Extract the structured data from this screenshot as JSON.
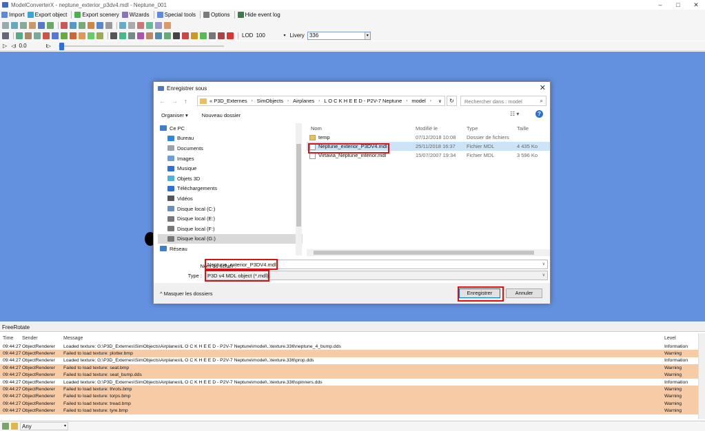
{
  "window": {
    "title": "ModelConverterX - neptune_exterior_p3dv4.mdl - Neptune_001",
    "controls": [
      "–",
      "□",
      "✕"
    ]
  },
  "menubar": [
    {
      "label": "Import",
      "icon": "import-icon",
      "color": "#5b8ad6"
    },
    {
      "label": "Export object",
      "icon": "export-object-icon",
      "color": "#3aa5d8"
    },
    {
      "label": "Export scenery",
      "icon": "export-scenery-icon",
      "color": "#4caf50"
    },
    {
      "label": "Wizards",
      "icon": "wizard-icon",
      "color": "#8a6fc7"
    },
    {
      "label": "Special tools",
      "icon": "special-tools-icon",
      "color": "#5a8de0"
    },
    {
      "label": "Options",
      "icon": "options-icon",
      "color": "#7a7a7a"
    },
    {
      "label": "Hide event log",
      "icon": "event-log-icon",
      "color": "#3a7d44"
    }
  ],
  "toolbar": {
    "lod_label": "LOD",
    "lod_value": "100",
    "livery_label": "Livery",
    "livery_value": "336"
  },
  "playback": {
    "time": "0.0"
  },
  "dialog": {
    "title": "Enregistrer sous",
    "breadcrumb": [
      "« P3D_Externes",
      "SimObjects",
      "Airplanes",
      "L O C K H E E D - P2V-7 Neptune",
      "model"
    ],
    "search_placeholder": "Rechercher dans : model",
    "organize_label": "Organiser ▾",
    "new_folder_label": "Nouveau dossier",
    "nav_items": [
      {
        "label": "Ce PC",
        "icon": "pc-icon",
        "color": "#3b7fd0"
      },
      {
        "label": "Bureau",
        "icon": "desktop-icon",
        "color": "#2e86de"
      },
      {
        "label": "Documents",
        "icon": "documents-icon",
        "color": "#9aa3ad"
      },
      {
        "label": "Images",
        "icon": "images-icon",
        "color": "#6aa0d8"
      },
      {
        "label": "Musique",
        "icon": "music-icon",
        "color": "#2e6fd8"
      },
      {
        "label": "Objets 3D",
        "icon": "objects3d-icon",
        "color": "#4ab1e0"
      },
      {
        "label": "Téléchargements",
        "icon": "downloads-icon",
        "color": "#2e6fd8"
      },
      {
        "label": "Vidéos",
        "icon": "videos-icon",
        "color": "#555"
      },
      {
        "label": "Disque local (C:)",
        "icon": "drive-c-icon",
        "color": "#6b8fb8"
      },
      {
        "label": "Disque local (E:)",
        "icon": "drive-e-icon",
        "color": "#777"
      },
      {
        "label": "Disque local (F:)",
        "icon": "drive-f-icon",
        "color": "#777"
      },
      {
        "label": "Disque local (G:)",
        "icon": "drive-g-icon",
        "color": "#777"
      },
      {
        "label": "Réseau",
        "icon": "network-icon",
        "color": "#3b7fd0"
      }
    ],
    "file_columns": [
      "Nom",
      "Modifié le",
      "Type",
      "Taille"
    ],
    "files": [
      {
        "name": "temp",
        "modified": "07/12/2018 10:08",
        "type": "Dossier de fichiers",
        "size": "",
        "kind": "folder"
      },
      {
        "name": "Neptune_exterior_P3DV4.mdl",
        "modified": "25/11/2018 16:37",
        "type": "Fichier MDL",
        "size": "4 435 Ko",
        "kind": "file"
      },
      {
        "name": "Virtavia_Neptune_interior.mdl",
        "modified": "15/07/2007 19:34",
        "type": "Fichier MDL",
        "size": "3 596 Ko",
        "kind": "file"
      }
    ],
    "filename_label": "Nom du fichier :",
    "filename_value": "Neptune_exterior_P3DV4.mdl",
    "type_label": "Type :",
    "type_value": "P3D v4 MDL object (*.mdl)",
    "hide_folders_label": "Masquer les dossiers",
    "save_label": "Enregistrer",
    "cancel_label": "Annuler"
  },
  "freerotate": "FreeRotate",
  "log": {
    "columns": [
      "Time",
      "Sender",
      "Message",
      "Level"
    ],
    "rows": [
      {
        "time": "09:44:27",
        "sender": "ObjectRenderer",
        "message": "Loaded texture: G:\\P3D_Externes\\SimObjects\\Airplanes\\L O C K H E E D - P2V-7 Neptune\\model\\..\\texture.336\\neptune_4_bump.dds",
        "level": "Information",
        "warn": false
      },
      {
        "time": "09:44:27",
        "sender": "ObjectRenderer",
        "message": "Failed to load texture: plotter.bmp",
        "level": "Warning",
        "warn": true
      },
      {
        "time": "09:44:27",
        "sender": "ObjectRenderer",
        "message": "Loaded texture: G:\\P3D_Externes\\SimObjects\\Airplanes\\L O C K H E E D - P2V-7 Neptune\\model\\..\\texture.336\\prop.dds",
        "level": "Information",
        "warn": false
      },
      {
        "time": "09:44:27",
        "sender": "ObjectRenderer",
        "message": "Failed to load texture: seat.bmp",
        "level": "Warning",
        "warn": true
      },
      {
        "time": "09:44:27",
        "sender": "ObjectRenderer",
        "message": "Failed to load texture: seat_bump.dds",
        "level": "Warning",
        "warn": true
      },
      {
        "time": "09:44:27",
        "sender": "ObjectRenderer",
        "message": "Loaded texture: G:\\P3D_Externes\\SimObjects\\Airplanes\\L O C K H E E D - P2V-7 Neptune\\model\\..\\texture.336\\spinners.dds",
        "level": "Information",
        "warn": false
      },
      {
        "time": "09:44:27",
        "sender": "ObjectRenderer",
        "message": "Failed to load texture: throts.bmp",
        "level": "Warning",
        "warn": true
      },
      {
        "time": "09:44:27",
        "sender": "ObjectRenderer",
        "message": "Failed to load texture: torps.bmp",
        "level": "Warning",
        "warn": true
      },
      {
        "time": "09:44:27",
        "sender": "ObjectRenderer",
        "message": "Failed to load texture: tread.bmp",
        "level": "Warning",
        "warn": true
      },
      {
        "time": "09:44:27",
        "sender": "ObjectRenderer",
        "message": "Failed to load texture: tyre.bmp",
        "level": "Warning",
        "warn": true
      }
    ]
  },
  "statusbar": {
    "filter_value": "Any"
  },
  "colors": {
    "viewport_bg": "#6391e0",
    "warning_row": "#f8cba7",
    "highlight": "#d11111",
    "selection": "#cce4f7"
  }
}
